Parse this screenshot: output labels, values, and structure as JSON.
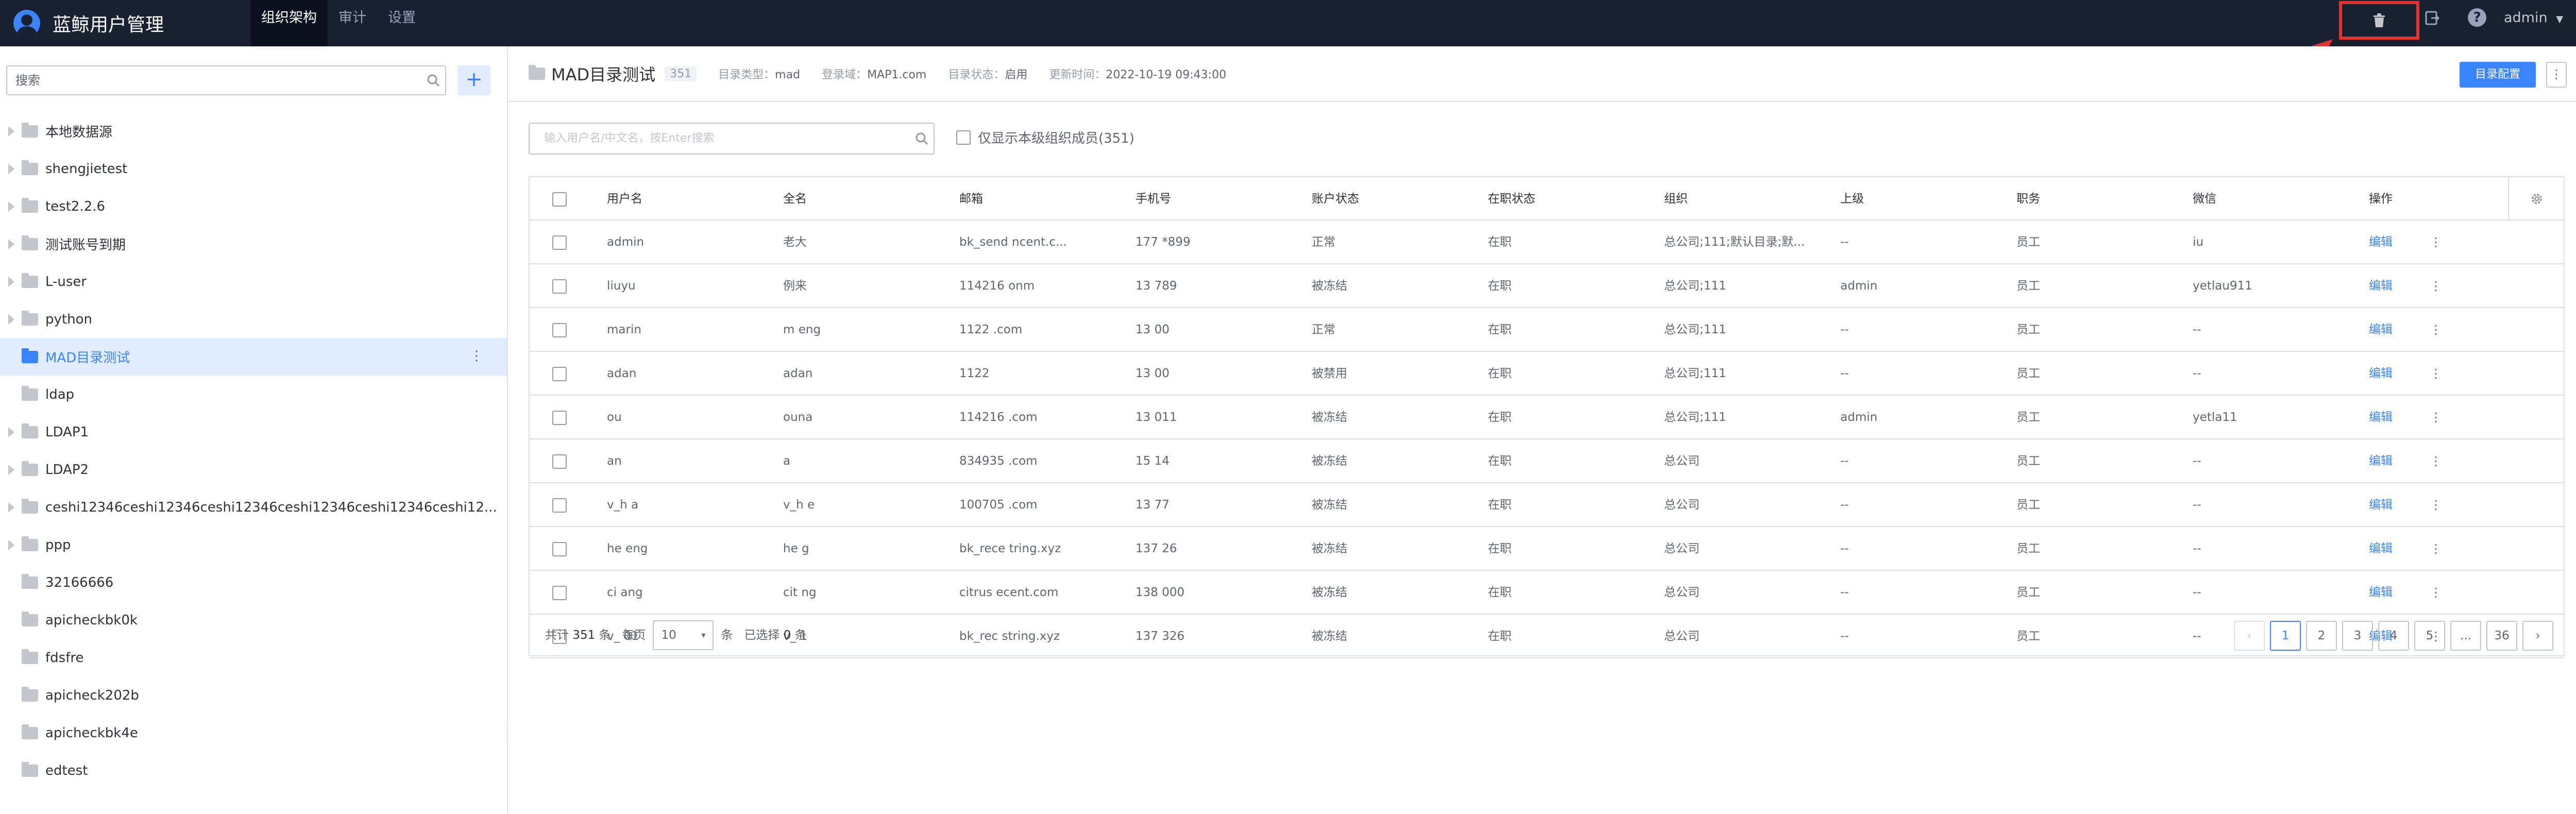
{
  "app": {
    "title": "蓝鲸用户管理"
  },
  "nav": [
    {
      "label": "组织架构"
    },
    {
      "label": "审计"
    },
    {
      "label": "设置"
    }
  ],
  "topbar": {
    "user": "admin"
  },
  "sidebar": {
    "search_placeholder": "搜索",
    "add_label": "+",
    "items": [
      {
        "label": "本地数据源"
      },
      {
        "label": "shengjietest"
      },
      {
        "label": "test2.2.6"
      },
      {
        "label": "测试账号到期"
      },
      {
        "label": "L-user"
      },
      {
        "label": "python"
      },
      {
        "label": "MAD目录测试"
      },
      {
        "label": "ldap"
      },
      {
        "label": "LDAP1"
      },
      {
        "label": "LDAP2"
      },
      {
        "label": "ceshi12346ceshi12346ceshi12346ceshi12346ceshi12346ceshi12..."
      },
      {
        "label": "ppp"
      },
      {
        "label": "32166666"
      },
      {
        "label": "apicheckbk0k"
      },
      {
        "label": "fdsfre"
      },
      {
        "label": "apicheck202b"
      },
      {
        "label": "apicheckbk4e"
      },
      {
        "label": "edtest"
      }
    ]
  },
  "header": {
    "title": "MAD目录测试",
    "count": "351",
    "type_label": "目录类型：",
    "type_value": "mad",
    "domain_label": "登录域：",
    "domain_value": "MAP1.com",
    "status_label": "目录状态：",
    "status_value": "启用",
    "updated_label": "更新时间：",
    "updated_value": "2022-10-19 09:43:00",
    "config_button": "目录配置",
    "more": "⋮"
  },
  "filters": {
    "search_placeholder": "输入用户名/中文名，按Enter搜索",
    "only_this_level": "仅显示本级组织成员(351)"
  },
  "table": {
    "columns": [
      "用户名",
      "全名",
      "邮箱",
      "手机号",
      "账户状态",
      "在职状态",
      "组织",
      "上级",
      "职务",
      "微信",
      "操作"
    ],
    "rows": [
      {
        "username": "admin",
        "fullname": "老大",
        "email": "bk_send        ncent.c...",
        "phone": "177        *899",
        "status": "正常",
        "job_status": "在职",
        "org": "总公司;111;默认目录;默...",
        "leader": "--",
        "title": "员工",
        "wechat": "iu",
        "edit": "编辑"
      },
      {
        "username": "liuyu",
        "fullname": "例来",
        "email": "114216           onm",
        "phone": "13          789",
        "status": "被冻结",
        "job_status": "在职",
        "org": "总公司;111",
        "leader": "admin",
        "title": "员工",
        "wechat": "yetlau911",
        "edit": "编辑"
      },
      {
        "username": "marin",
        "fullname": "m       eng",
        "email": "1122         .com",
        "phone": "13          00",
        "status": "正常",
        "job_status": "在职",
        "org": "总公司;111",
        "leader": "--",
        "title": "员工",
        "wechat": "--",
        "edit": "编辑"
      },
      {
        "username": "adan",
        "fullname": "adan",
        "email": "1122",
        "phone": "13          00",
        "status": "被禁用",
        "job_status": "在职",
        "org": "总公司;111",
        "leader": "--",
        "title": "员工",
        "wechat": "--",
        "edit": "编辑"
      },
      {
        "username": "ou",
        "fullname": "ouna",
        "email": "114216          .com",
        "phone": "13          011",
        "status": "被冻结",
        "job_status": "在职",
        "org": "总公司;111",
        "leader": "admin",
        "title": "员工",
        "wechat": "yetla11",
        "edit": "编辑"
      },
      {
        "username": "      an",
        "fullname": "      a",
        "email": "834935           .com",
        "phone": "15          14",
        "status": "被冻结",
        "job_status": "在职",
        "org": "总公司",
        "leader": "--",
        "title": "员工",
        "wechat": "--",
        "edit": "编辑"
      },
      {
        "username": "v_h       a",
        "fullname": "v_h       e",
        "email": "100705          .com",
        "phone": "13          77",
        "status": "被冻结",
        "job_status": "在职",
        "org": "总公司",
        "leader": "--",
        "title": "员工",
        "wechat": "--",
        "edit": "编辑"
      },
      {
        "username": "he       eng",
        "fullname": "he       g",
        "email": "bk_rece          tring.xyz",
        "phone": "137          26",
        "status": "被冻结",
        "job_status": "在职",
        "org": "总公司",
        "leader": "--",
        "title": "员工",
        "wechat": "--",
        "edit": "编辑"
      },
      {
        "username": "ci       ang",
        "fullname": "cit       ng",
        "email": "citrus          ecent.com",
        "phone": "138          000",
        "status": "被冻结",
        "job_status": "在职",
        "org": "总公司",
        "leader": "--",
        "title": "员工",
        "wechat": "--",
        "edit": "编辑"
      },
      {
        "username": "v_      01",
        "fullname": "v_       1",
        "email": "bk_rec          string.xyz",
        "phone": "137          326",
        "status": "被冻结",
        "job_status": "在职",
        "org": "总公司",
        "leader": "--",
        "title": "员工",
        "wechat": "--",
        "edit": "编辑"
      }
    ]
  },
  "pagination": {
    "total_prefix": "共计",
    "total": "351",
    "total_suffix": "条",
    "per_page_label": "每页",
    "per_page": "10",
    "per_page_suffix": "条",
    "selected_prefix": "已选择",
    "selected": "0",
    "selected_suffix": "条",
    "pages": [
      "1",
      "2",
      "3",
      "4",
      "5",
      "...",
      "36"
    ],
    "current": "1"
  },
  "colors": {
    "topbar": "#182132",
    "accent": "#3a84ff",
    "highlight": "#e5322d"
  }
}
